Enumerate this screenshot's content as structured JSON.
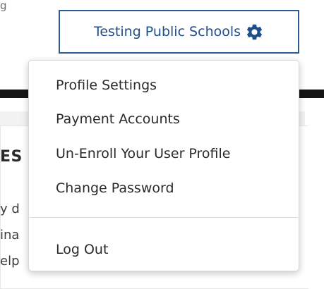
{
  "page": {
    "top_fragment": "g",
    "section_heading_fragment": "ES",
    "text_fragments": [
      "y d",
      "ina",
      "elp"
    ]
  },
  "school_selector": {
    "label": "Testing Public Schools",
    "icon": "gear-icon",
    "accent_color": "#1f4f8a",
    "border_color": "#2d5c93"
  },
  "menu": {
    "items": [
      {
        "label": "Profile Settings"
      },
      {
        "label": "Payment Accounts"
      },
      {
        "label": "Un-Enroll Your User Profile"
      },
      {
        "label": "Change Password"
      }
    ],
    "logout_label": "Log Out"
  }
}
